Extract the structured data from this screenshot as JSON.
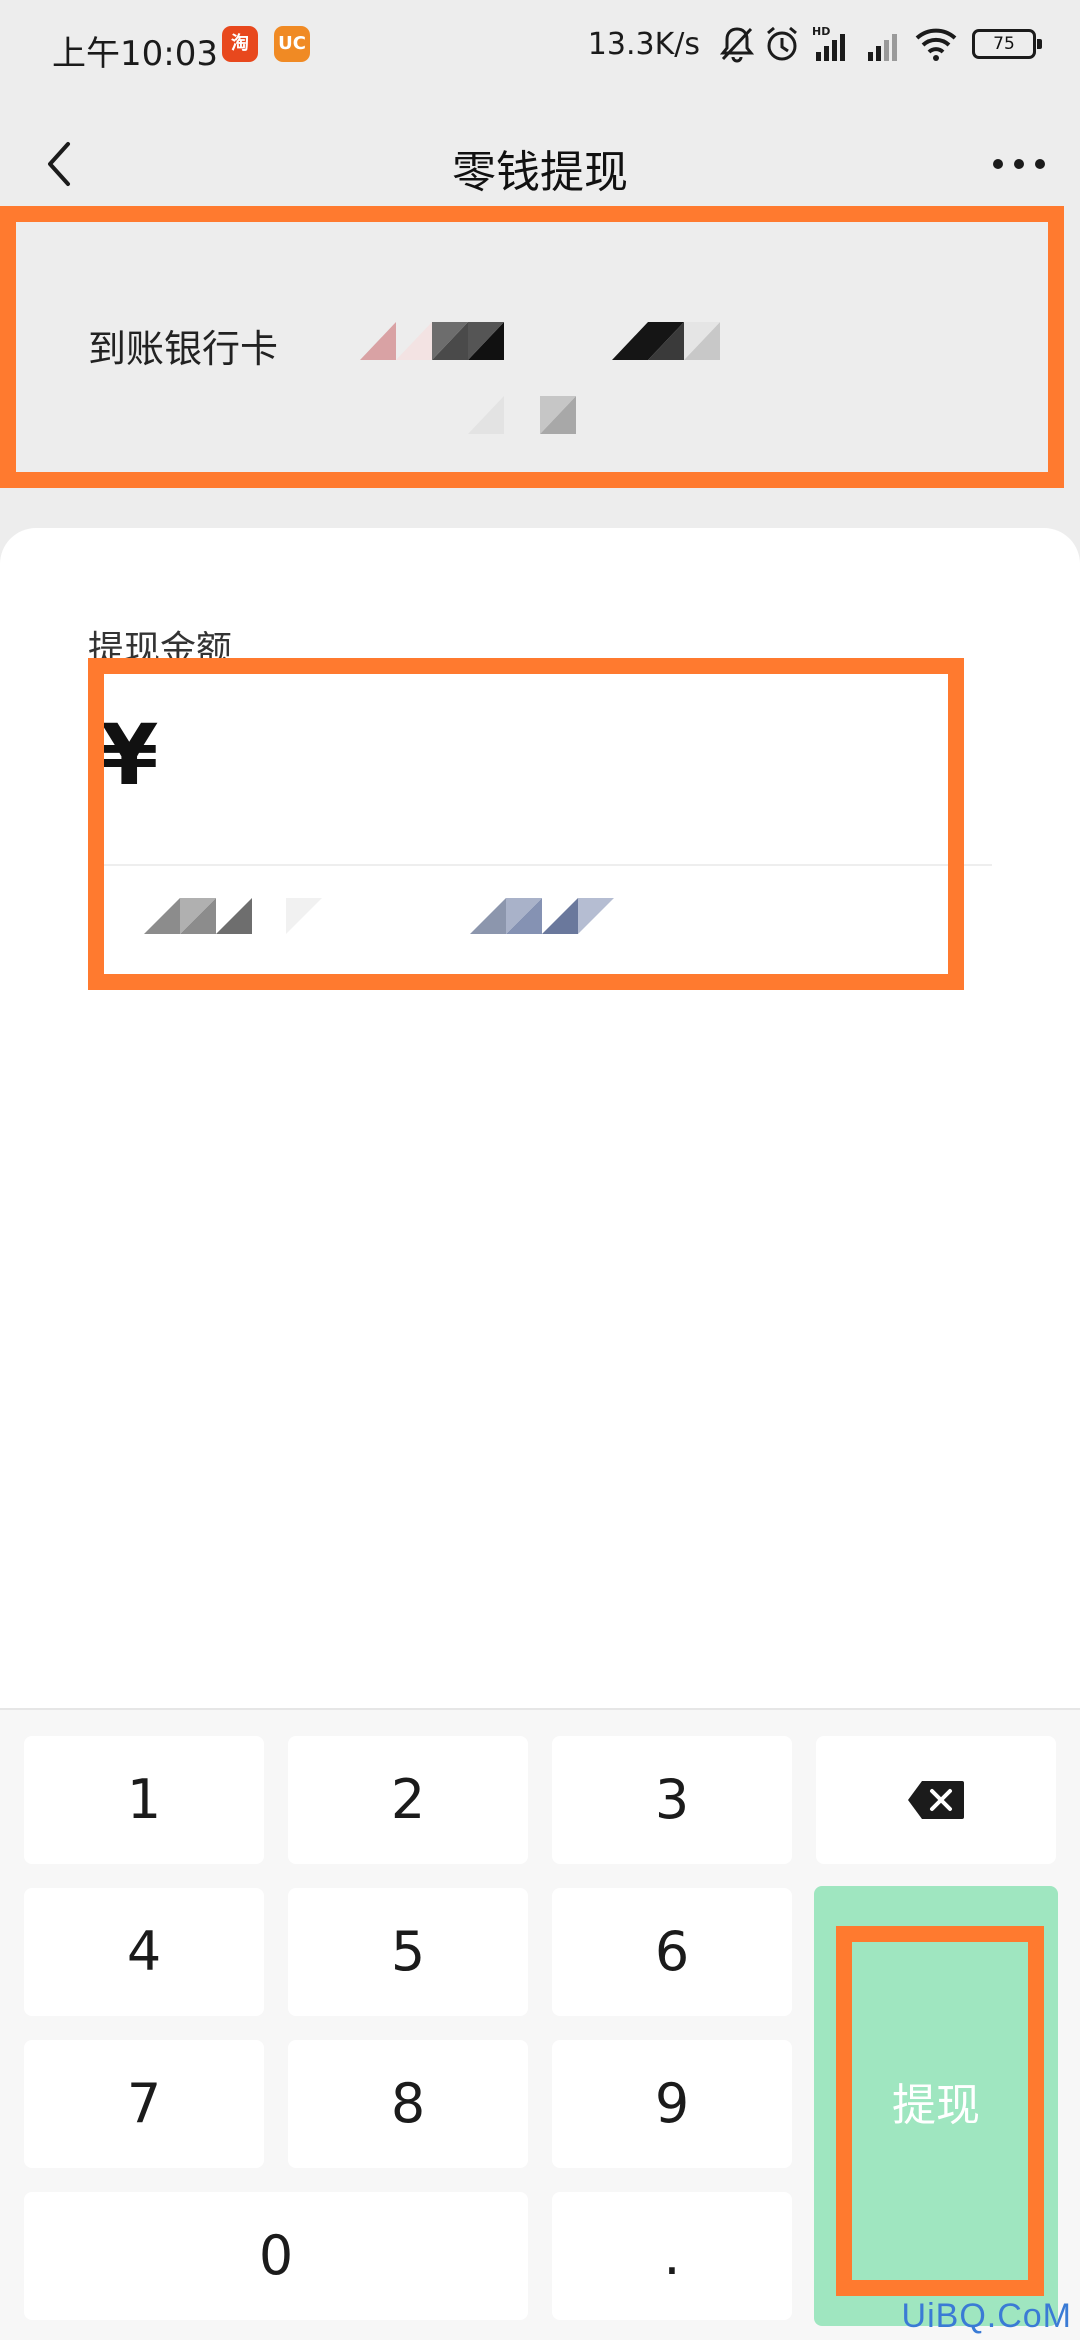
{
  "status_bar": {
    "time": "上午10:03",
    "app_icons": [
      "taobao-icon",
      "uc-browser-icon"
    ],
    "taobao_glyph": "淘",
    "uc_glyph": "UC",
    "network_speed": "13.3K/s",
    "battery": "75",
    "hd_label": "HD"
  },
  "nav": {
    "title": "零钱提现"
  },
  "bank": {
    "label": "到账银行卡"
  },
  "amount": {
    "label": "提现金额",
    "currency_symbol": "¥",
    "value": ""
  },
  "keypad": {
    "keys": [
      "1",
      "2",
      "3",
      "4",
      "5",
      "6",
      "7",
      "8",
      "9",
      "0",
      "."
    ],
    "submit_label": "提现"
  },
  "watermark": "UiBQ.CoM",
  "colors": {
    "highlight": "#ff7a2f",
    "submit_bg": "#9fe6c0",
    "page_bg": "#ededed"
  }
}
